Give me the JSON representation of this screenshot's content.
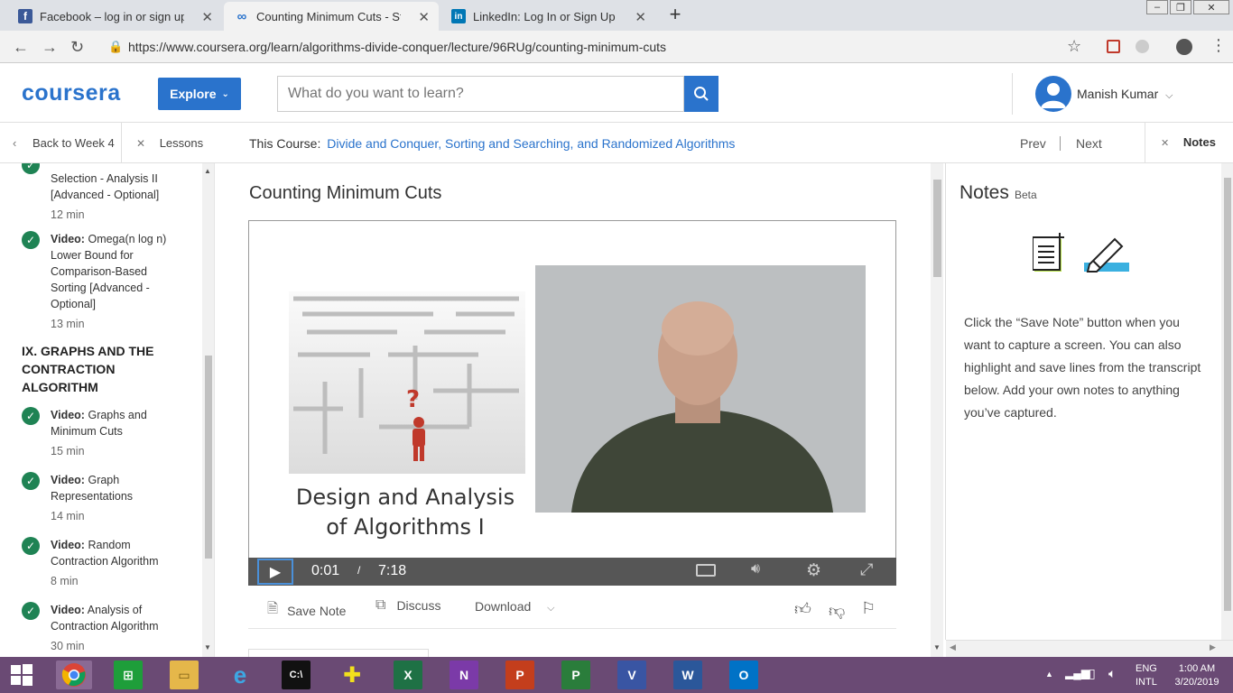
{
  "browser": {
    "tabs": [
      {
        "title": "Facebook – log in or sign up",
        "icon": "facebook-icon",
        "color": "#3b5998"
      },
      {
        "title": "Counting Minimum Cuts - Stanfo",
        "icon": "coursera-tab-icon",
        "color": "#2a73cc"
      },
      {
        "title": "LinkedIn: Log In or Sign Up",
        "icon": "linkedin-icon",
        "color": "#0077b5"
      }
    ],
    "url": "https://www.coursera.org/learn/algorithms-divide-conquer/lecture/96RUg/counting-minimum-cuts"
  },
  "header": {
    "logo": "coursera",
    "explore_label": "Explore",
    "search_placeholder": "What do you want to learn?",
    "user_name": "Manish Kumar",
    "brand_color": "#2a73cc"
  },
  "course_bar": {
    "back_label": "Back to Week 4",
    "lessons_label": "Lessons",
    "this_course_label": "This Course:",
    "course_name": "Divide and Conquer, Sorting and Searching, and Randomized Algorithms",
    "prev_label": "Prev",
    "next_label": "Next",
    "notes_label": "Notes"
  },
  "sidebar": {
    "partial_item": {
      "line1": "Selection - Analysis II",
      "line2": "[Advanced - Optional]",
      "duration": "12 min"
    },
    "item_omega": {
      "prefix": "Video:",
      "title_1": "Omega(n log n)",
      "title_2": "Lower Bound for",
      "title_3": "Comparison-Based",
      "title_4": "Sorting [Advanced -",
      "title_5": "Optional]",
      "duration": "13 min"
    },
    "section_title_1": "IX. GRAPHS AND THE",
    "section_title_2": "CONTRACTION",
    "section_title_3": "ALGORITHM",
    "items": [
      {
        "prefix": "Video:",
        "title_1": "Graphs and",
        "title_2": "Minimum Cuts",
        "duration": "15 min"
      },
      {
        "prefix": "Video:",
        "title_1": "Graph",
        "title_2": "Representations",
        "duration": "14 min"
      },
      {
        "prefix": "Video:",
        "title_1": "Random",
        "title_2": "Contraction Algorithm",
        "duration": "8 min"
      },
      {
        "prefix": "Video:",
        "title_1": "Analysis of",
        "title_2": "Contraction Algorithm",
        "duration": "30 min"
      }
    ]
  },
  "main": {
    "lecture_title": "Counting Minimum Cuts",
    "slide_line_1": "Design and Analysis",
    "slide_line_2": "of Algorithms I",
    "current_time": "0:01",
    "time_separator": "/",
    "total_time": "7:18",
    "save_note_label": "Save Note",
    "discuss_label": "Discuss",
    "download_label": "Download"
  },
  "notes_panel": {
    "title": "Notes",
    "beta": "Beta",
    "description": "Click the “Save Note” button when you want to capture a screen. You can also highlight and save lines from the transcript below. Add your own notes to anything you’ve captured."
  },
  "taskbar": {
    "lang_1": "ENG",
    "lang_2": "INTL",
    "time": "1:00 AM",
    "date": "3/20/2019"
  }
}
